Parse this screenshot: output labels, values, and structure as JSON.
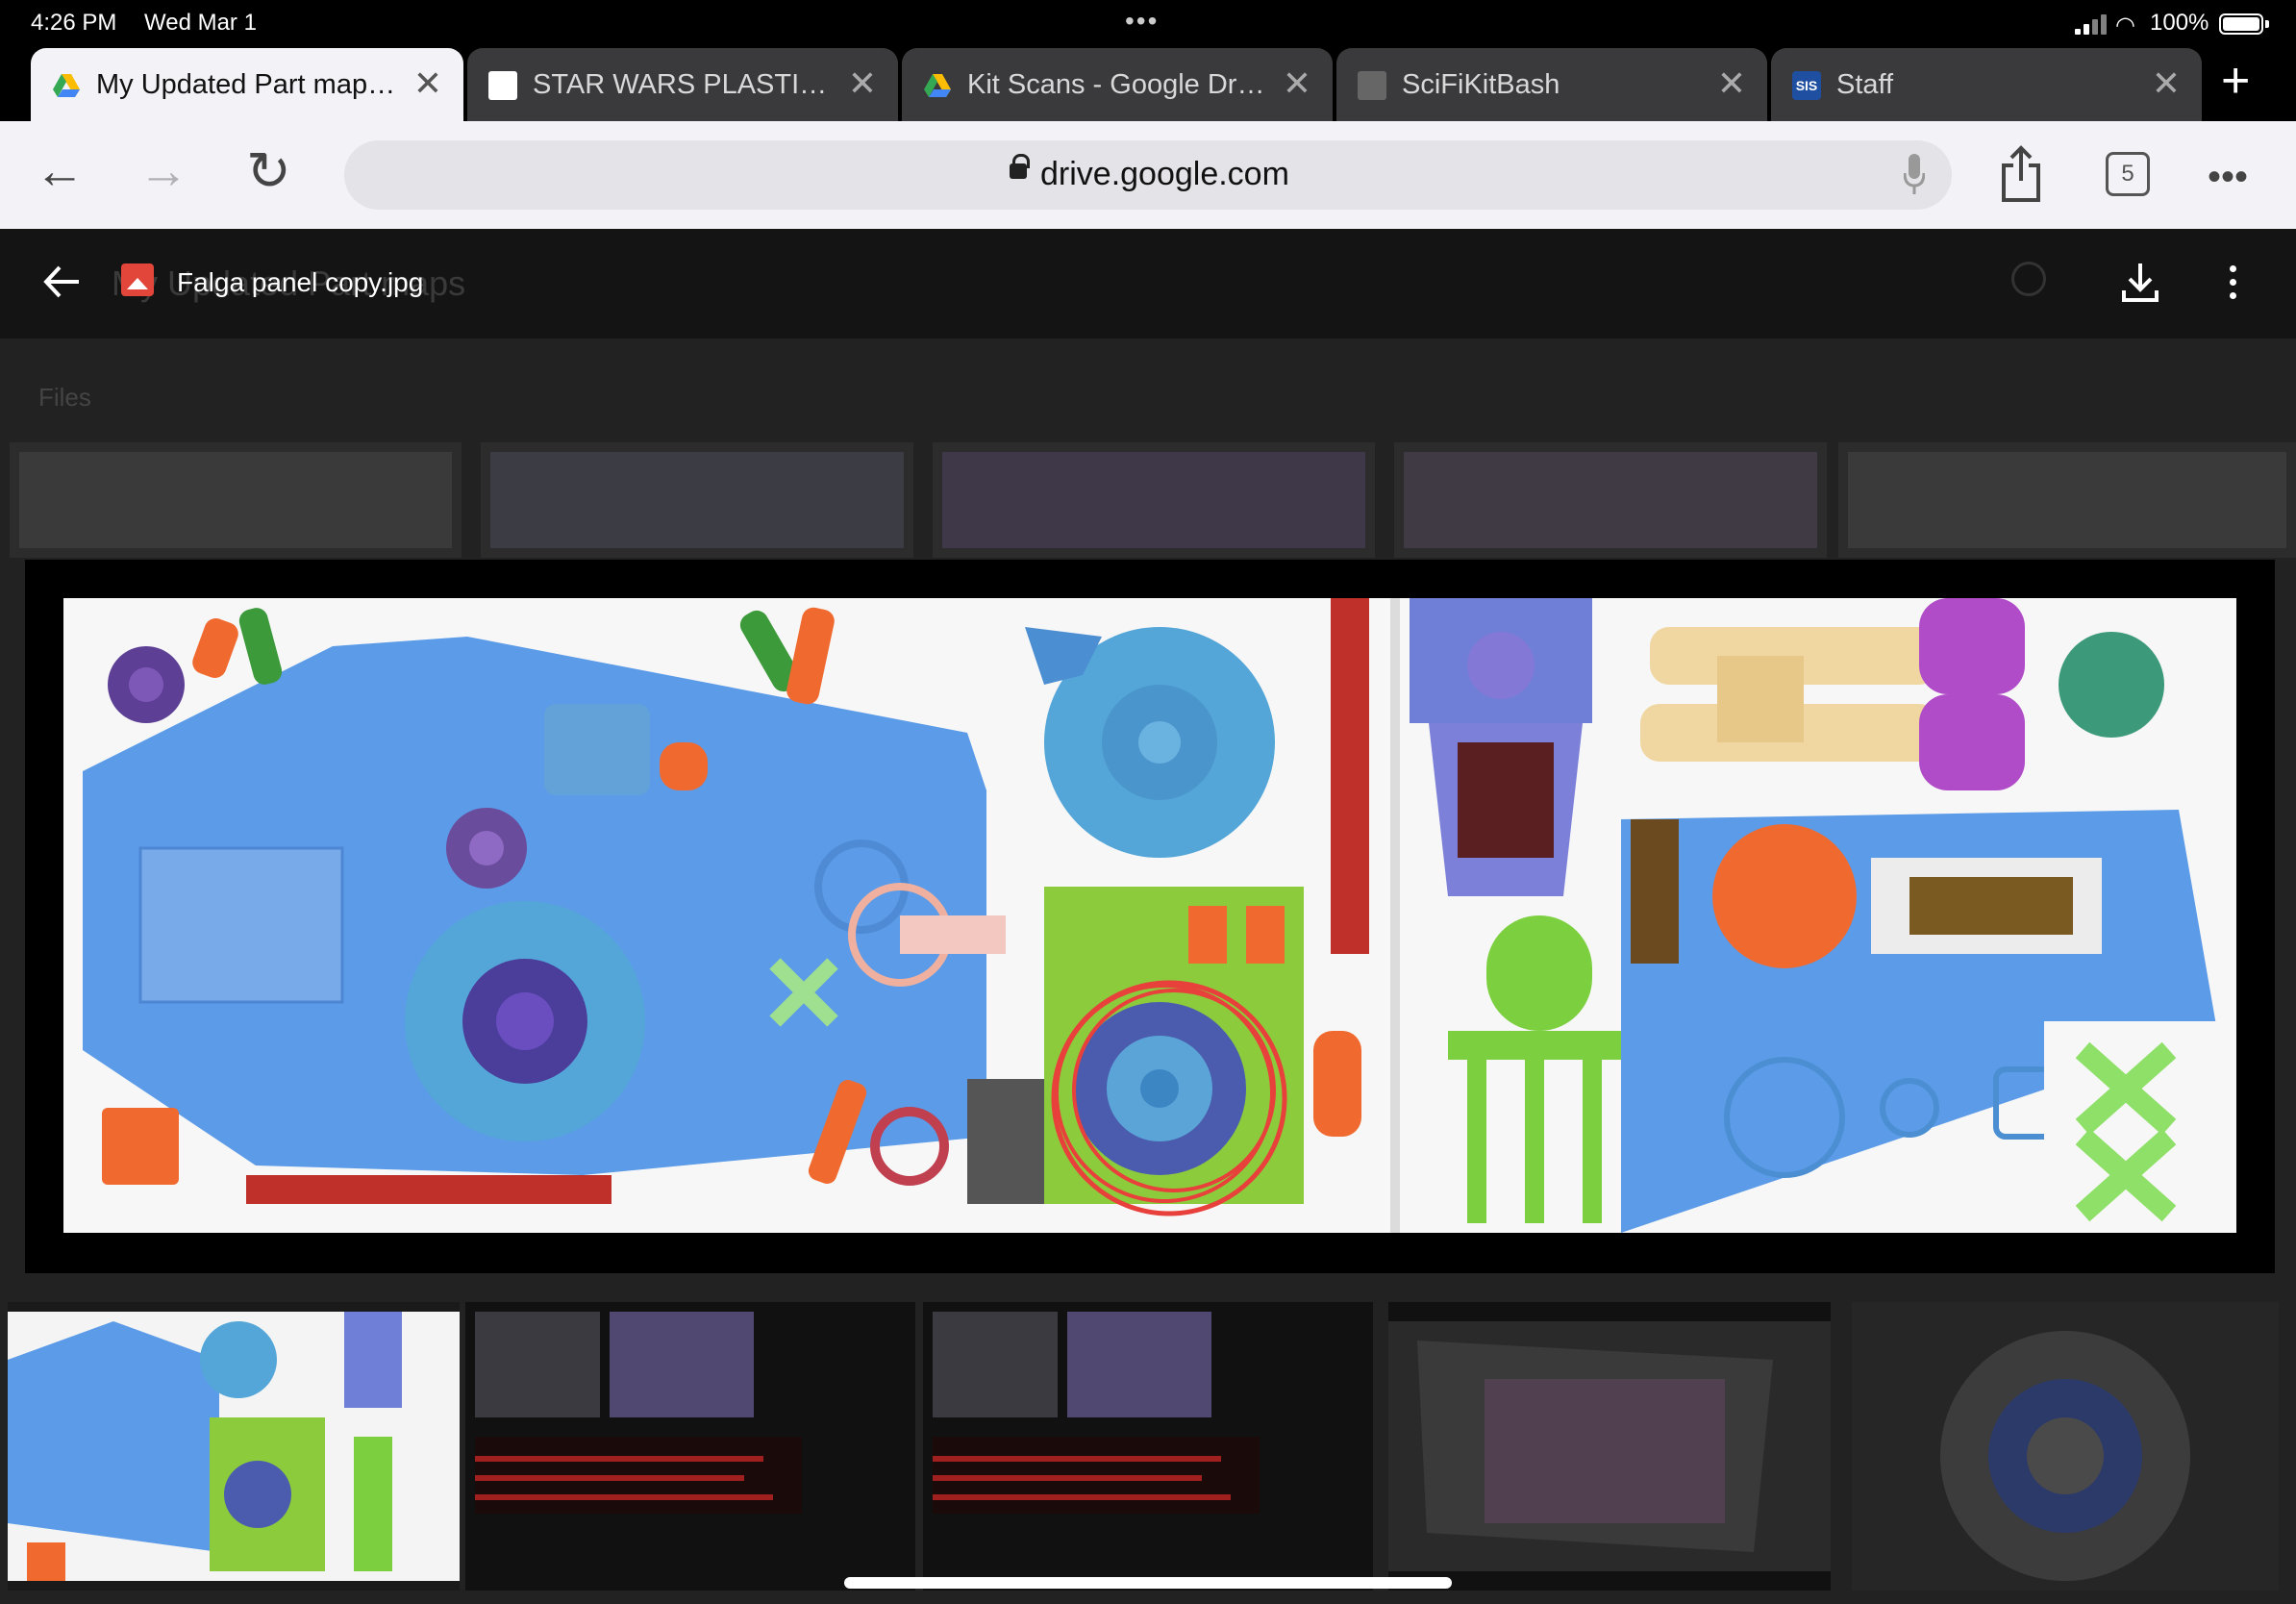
{
  "status_bar": {
    "time": "4:26 PM",
    "date": "Wed Mar 1",
    "battery": "100%"
  },
  "tabs": [
    {
      "title": "My Updated Part maps - Google Drive",
      "active": true,
      "favicon": "google-drive-icon"
    },
    {
      "title": "STAR WARS PLASTIC MODEL KITS",
      "active": false,
      "favicon": "site-icon"
    },
    {
      "title": "Kit Scans - Google Drive",
      "active": false,
      "favicon": "google-drive-icon"
    },
    {
      "title": "SciFiKitBash",
      "active": false,
      "favicon": "site-icon"
    },
    {
      "title": "Staff",
      "active": false,
      "favicon": "sis-icon"
    }
  ],
  "sis_favicon_label": "SIS",
  "toolbar": {
    "url": "drive.google.com",
    "tab_count": "5"
  },
  "drive_background": {
    "title": "My Updated Part maps",
    "files_label": "Files"
  },
  "viewer": {
    "file_name": "Falga panel copy.jpg"
  },
  "colors": {
    "accent_blue": "#5b9be8",
    "highlight_red": "#e8403a",
    "part_green": "#8ccc3c",
    "part_orange": "#f06a30",
    "part_purple": "#6a3c9a"
  }
}
